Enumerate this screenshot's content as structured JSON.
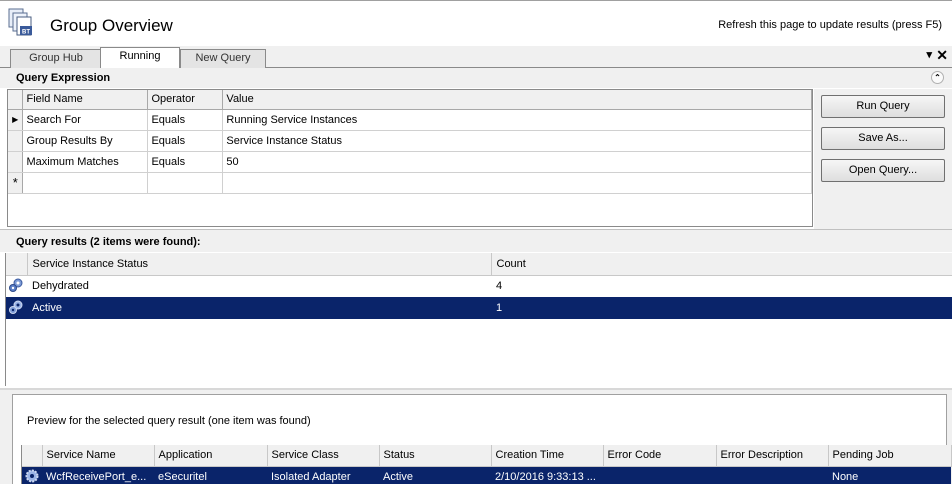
{
  "header": {
    "title": "Group Overview",
    "logo_badge": "BT",
    "refresh_hint": "Refresh this page to update results (press F5)"
  },
  "tabs": [
    {
      "label": "Group Hub",
      "active": false
    },
    {
      "label": "Running",
      "active": true
    },
    {
      "label": "New Query",
      "active": false
    }
  ],
  "tabbar": {
    "pin_glyph": "▾",
    "close_glyph": "✕"
  },
  "query_expression": {
    "title": "Query Expression",
    "columns": [
      "Field Name",
      "Operator",
      "Value"
    ],
    "rows": [
      {
        "field": "Search For",
        "operator": "Equals",
        "value": "Running Service Instances",
        "current": true
      },
      {
        "field": "Group Results By",
        "operator": "Equals",
        "value": "Service Instance Status",
        "current": false
      },
      {
        "field": "Maximum Matches",
        "operator": "Equals",
        "value": "50",
        "current": false
      }
    ],
    "new_row_marker": "*",
    "current_row_marker": "▶"
  },
  "buttons": {
    "run": "Run Query",
    "save": "Save As...",
    "open": "Open Query..."
  },
  "results": {
    "title": "Query results (2 items were found):",
    "columns": [
      "Service Instance Status",
      "Count"
    ],
    "rows": [
      {
        "status": "Dehydrated",
        "count": "4",
        "selected": false,
        "icon": "service-gear-icon"
      },
      {
        "status": "Active",
        "count": "1",
        "selected": true,
        "icon": "service-gear-icon"
      }
    ]
  },
  "preview": {
    "caption": "Preview for the selected query result (one item was found)",
    "columns": [
      "Service Name",
      "Application",
      "Service Class",
      "Status",
      "Creation Time",
      "Error Code",
      "Error Description",
      "Pending Job"
    ],
    "rows": [
      {
        "service_name": "WcfReceivePort_e...",
        "application": "eSecuritel",
        "service_class": "Isolated Adapter",
        "status": "Active",
        "creation_time": "2/10/2016 9:33:13 ...",
        "error_code": "",
        "error_description": "",
        "pending_job": "None",
        "selected": true,
        "icon": "service-gear-icon"
      }
    ]
  },
  "colors": {
    "selection": "#0a246a",
    "panel": "#f0f0f0"
  }
}
